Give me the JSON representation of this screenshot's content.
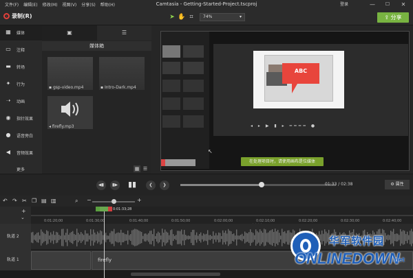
{
  "menubar": {
    "items": [
      "文件(F)",
      "编辑(E)",
      "修改(M)",
      "视图(V)",
      "分享(S)",
      "帮助(H)"
    ],
    "title": "Camtasia - Getting-Started-Project.tscproj",
    "login": "登录",
    "minimize": "—",
    "maximize": "☐",
    "close": "✕"
  },
  "toolbar": {
    "record_label": "录制(R)",
    "zoom_value": "74%",
    "share_label": "分享"
  },
  "left_tools": [
    {
      "label": "媒体",
      "icon": "film-icon"
    },
    {
      "label": "注释",
      "icon": "annotation-icon"
    },
    {
      "label": "转场",
      "icon": "transition-icon"
    },
    {
      "label": "行为",
      "icon": "behavior-icon"
    },
    {
      "label": "动画",
      "icon": "animation-icon"
    },
    {
      "label": "指针效果",
      "icon": "cursor-effect-icon"
    },
    {
      "label": "语音旁白",
      "icon": "microphone-icon"
    },
    {
      "label": "音频效果",
      "icon": "audio-effect-icon"
    }
  ],
  "more_label": "更多",
  "media_bin": {
    "title": "媒体箱",
    "items": [
      {
        "name": "gsp-video.mp4",
        "kind": "video"
      },
      {
        "name": "Intro-Dark.mp4",
        "kind": "video"
      },
      {
        "name": "firefly.mp3",
        "kind": "audio"
      }
    ]
  },
  "canvas": {
    "abc_text": "ABC",
    "notice": "在处理项目时，请使用画布是位媒体"
  },
  "transport": {
    "time_current": "01:33",
    "time_total": "02:38",
    "properties_label": "属性",
    "progress": 0.52
  },
  "timeline": {
    "playhead_time": "0:01:33;28",
    "ticks": [
      "0:01:20;00",
      "0:01:30;00",
      "0:01:40;00",
      "0:01:50;00",
      "0:02:00;00",
      "0:02:10;00",
      "0:02:20;00",
      "0:02:30;00",
      "0:02:40;00"
    ],
    "tracks": [
      {
        "label": "轨道 2"
      },
      {
        "label": "轨道 1",
        "clip": "firefly"
      }
    ]
  },
  "watermark": {
    "line1": "华军软件园",
    "line2": "ONLINEDOWN",
    "suffix": ".net"
  },
  "colors": {
    "accent_green": "#78b341",
    "record_red": "#e0403a",
    "callout_red": "#e8453c"
  }
}
